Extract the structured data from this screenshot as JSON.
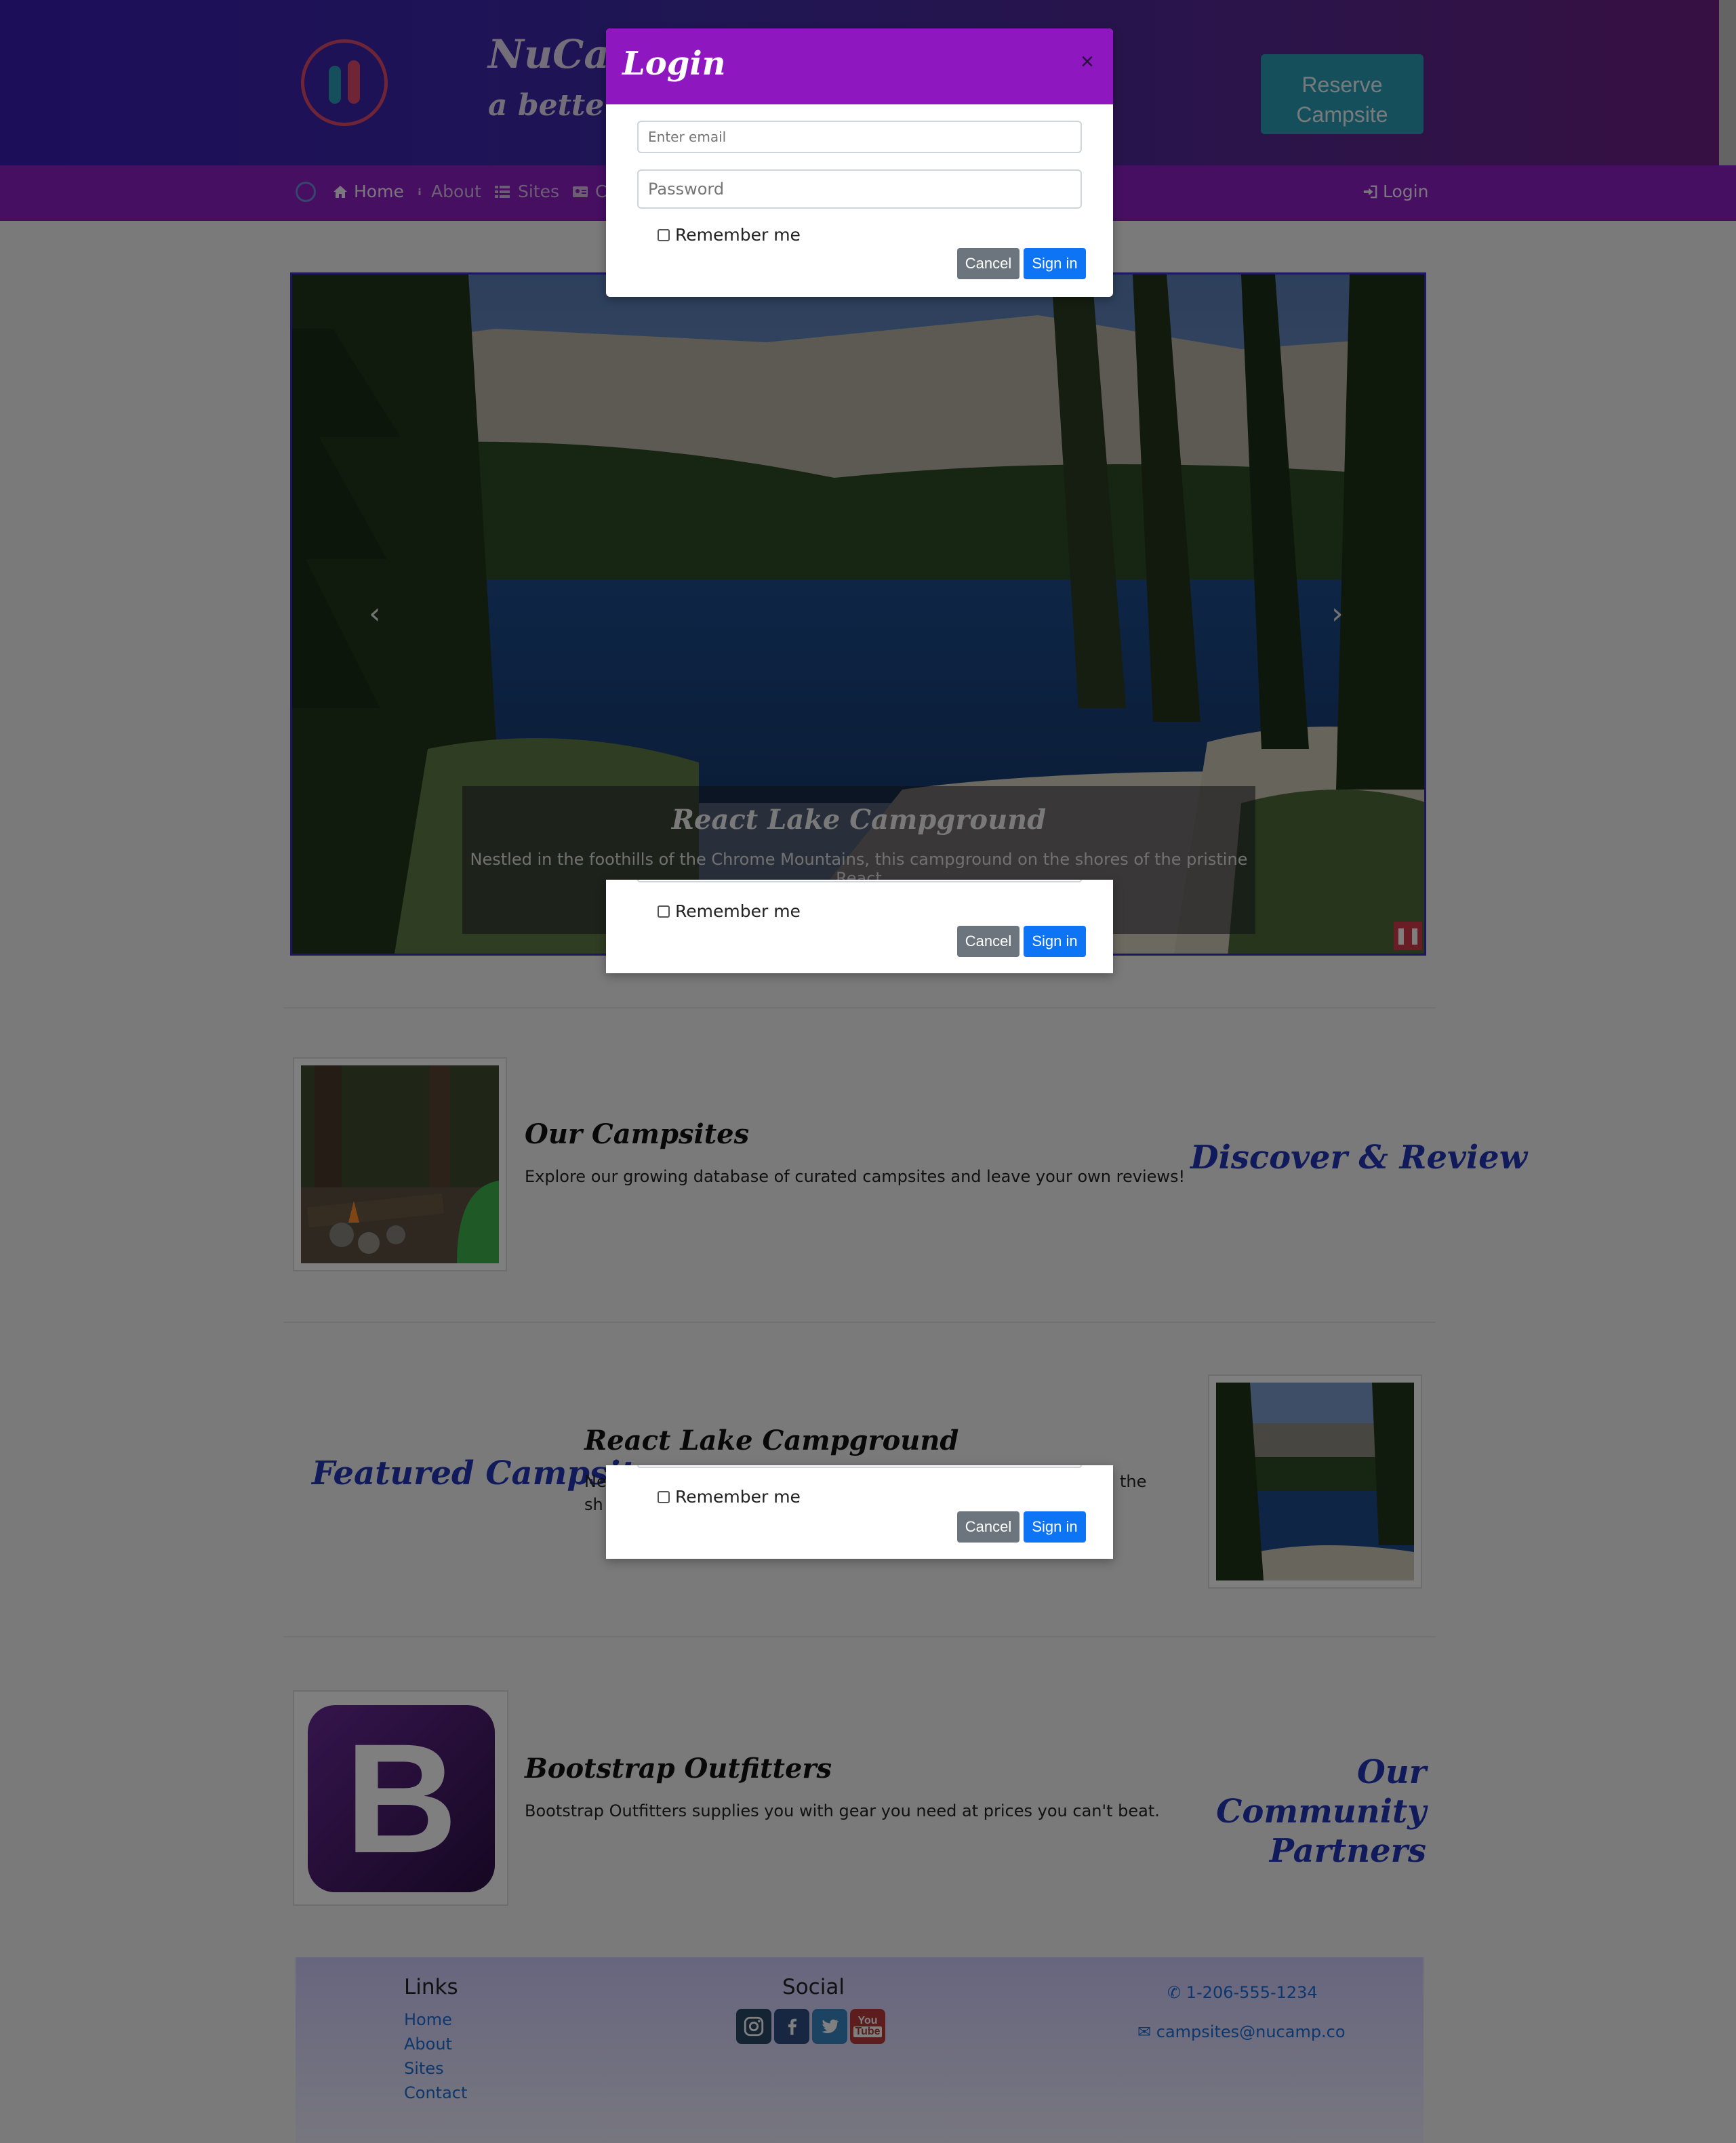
{
  "brand": {
    "title": "NuCamp",
    "tagline": "a better way to camp"
  },
  "header": {
    "reserve_label": "Reserve Campsite"
  },
  "nav": {
    "items": [
      {
        "label": "Home",
        "icon": "home-icon"
      },
      {
        "label": "About",
        "icon": "info-icon"
      },
      {
        "label": "Sites",
        "icon": "list-icon"
      },
      {
        "label": "Co",
        "icon": "contact-card-icon"
      }
    ],
    "login_label": "Login"
  },
  "carousel": {
    "caption_title": "React Lake Campground",
    "caption_text": "Nestled in the foothills of the Chrome Mountains, this campground on the shores of the pristine React"
  },
  "sections": {
    "campsites": {
      "title": "Our Campsites",
      "text": "Explore our growing database of curated campsites and leave your own reviews!",
      "heading": "Discover & Review"
    },
    "featured": {
      "heading": "Featured Campsites",
      "title": "React Lake Campground",
      "text_left_1": "Ne",
      "text_left_2": "sh",
      "text_right": "the"
    },
    "partners": {
      "title": "Bootstrap Outfitters",
      "text": "Bootstrap Outfitters supplies you with gear you need at prices you can't beat.",
      "heading_line1": "Our Community",
      "heading_line2": "Partners",
      "logo_letter": "B"
    }
  },
  "footer": {
    "links_heading": "Links",
    "links": [
      "Home",
      "About",
      "Sites",
      "Contact"
    ],
    "social_heading": "Social",
    "social": [
      {
        "name": "instagram-icon",
        "color": "#2a4966"
      },
      {
        "name": "facebook-icon",
        "color": "#2f4f84"
      },
      {
        "name": "twitter-icon",
        "color": "#3a86c4"
      },
      {
        "name": "youtube-icon",
        "color": "#b83a38"
      }
    ],
    "phone": "1-206-555-1234",
    "email": "campsites@nucamp.co"
  },
  "modal": {
    "title": "Login",
    "email_placeholder": "Enter email",
    "password_placeholder": "Password",
    "remember_label": "Remember me",
    "cancel_label": "Cancel",
    "signin_label": "Sign in",
    "close_glyph": "×"
  },
  "colors": {
    "header_gradient_start": "#3a1cb4",
    "nav_bg": "#8d1ec4",
    "modal_header": "#8e17bf",
    "primary": "#0d74f5",
    "secondary": "#6c757d",
    "reserve": "#2a9fb8",
    "section_heading": "#2236b8"
  }
}
